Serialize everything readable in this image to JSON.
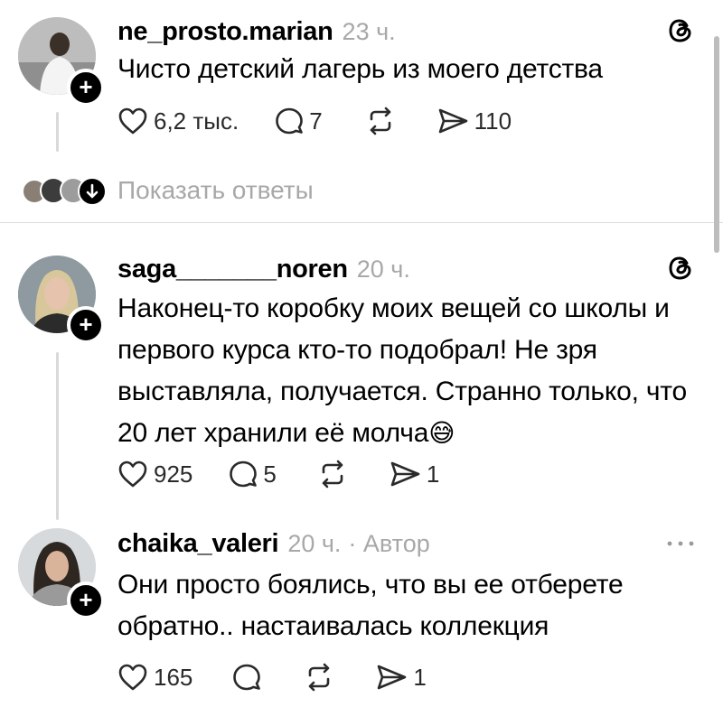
{
  "posts": [
    {
      "username": "ne_prosto.marian",
      "time": "23 ч.",
      "text_lines": [
        "Чисто детский лагерь из моего детства"
      ],
      "likes": "6,2 тыс.",
      "comments": "7",
      "shares": "110",
      "show_replies": "Показать ответы"
    },
    {
      "username": "saga_______noren",
      "time": "20 ч.",
      "text_lines": [
        "Наконец-то коробку моих вещей со школы и",
        "первого курса кто-то подобрал! Не зря",
        "выставляла, получается. Странно только, что",
        "20 лет хранили её молча"
      ],
      "emoji": "😅",
      "likes": "925",
      "comments": "5",
      "shares": "1"
    },
    {
      "username": "chaika_valeri",
      "time": "20 ч.",
      "author_badge": "· Автор",
      "text_lines": [
        "Они просто боялись, что вы ее отберете",
        "обратно.. настаивалась коллекция"
      ],
      "likes": "165",
      "comments": "",
      "shares": "1"
    }
  ],
  "icons": {
    "threads_logo": "threads-icon",
    "like": "heart-icon",
    "comment": "comment-icon",
    "repost": "repost-icon",
    "share": "send-icon",
    "more": "more-icon",
    "follow": "plus-icon"
  },
  "colors": {
    "meta_gray": "#a8a8a8",
    "divider": "#dcdcdc",
    "thread_line": "#d9d9d9"
  }
}
